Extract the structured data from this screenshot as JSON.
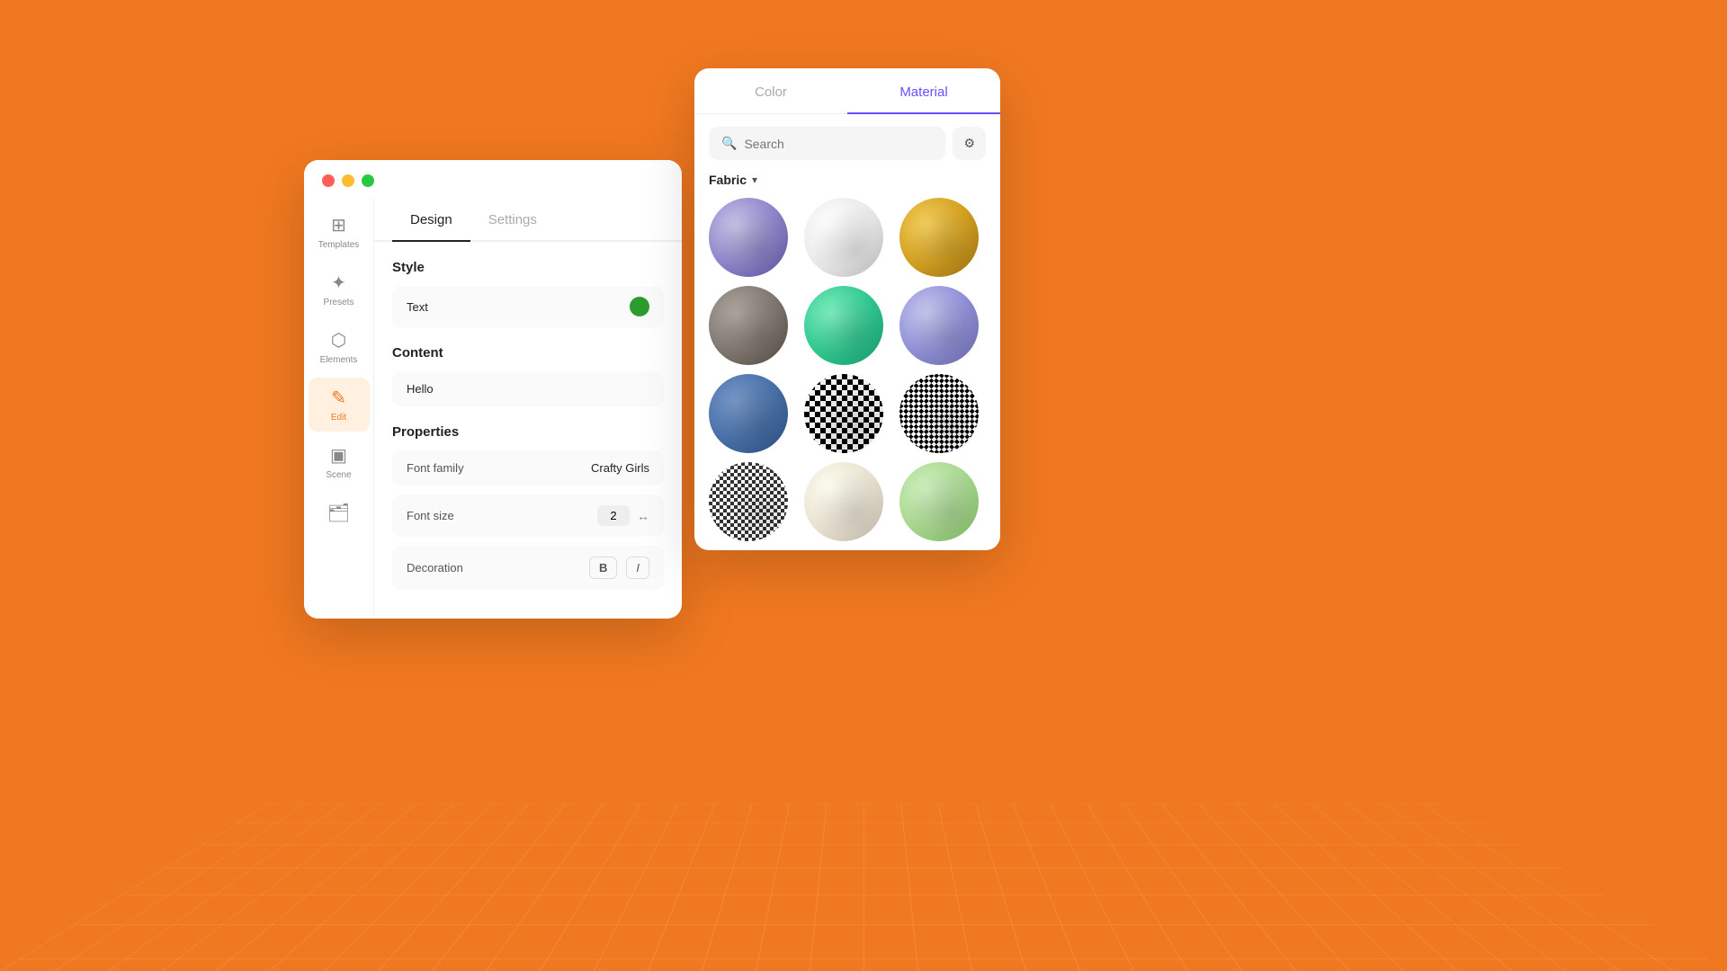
{
  "background": "#F07820",
  "left_panel": {
    "tabs": [
      {
        "id": "design",
        "label": "Design",
        "active": true
      },
      {
        "id": "settings",
        "label": "Settings",
        "active": false
      }
    ],
    "sidebar_items": [
      {
        "id": "templates",
        "label": "Templates",
        "icon": "⊞",
        "active": false
      },
      {
        "id": "presets",
        "label": "Presets",
        "icon": "✦",
        "active": false
      },
      {
        "id": "elements",
        "label": "Elements",
        "icon": "⬡",
        "active": false
      },
      {
        "id": "edit",
        "label": "Edit",
        "icon": "✎",
        "active": true
      },
      {
        "id": "scene",
        "label": "Scene",
        "icon": "▣",
        "active": false
      },
      {
        "id": "folder",
        "label": "",
        "icon": "🗂",
        "active": false
      }
    ],
    "style_section": {
      "title": "Style",
      "value": "Text"
    },
    "content_section": {
      "title": "Content",
      "value": "Hello"
    },
    "properties_section": {
      "title": "Properties",
      "font_family_label": "Font family",
      "font_family_value": "Crafty Girls",
      "font_size_label": "Font size",
      "font_size_value": "2",
      "decoration_label": "Decoration",
      "bold_label": "B",
      "italic_label": "I"
    }
  },
  "right_panel": {
    "tabs": [
      {
        "id": "color",
        "label": "Color",
        "active": false
      },
      {
        "id": "material",
        "label": "Material",
        "active": true
      }
    ],
    "search_placeholder": "Search",
    "filter_icon": "⚙",
    "fabric_label": "Fabric",
    "materials": [
      {
        "id": "lavender",
        "class": "mat-lavender"
      },
      {
        "id": "white-knit",
        "class": "mat-white-knit"
      },
      {
        "id": "gold",
        "class": "mat-gold"
      },
      {
        "id": "gray",
        "class": "mat-gray"
      },
      {
        "id": "mint",
        "class": "mat-mint"
      },
      {
        "id": "periwinkle",
        "class": "mat-periwinkle"
      },
      {
        "id": "blue-denim",
        "class": "mat-blue-denim"
      },
      {
        "id": "houndstooth",
        "class": "mat-houndstooth"
      },
      {
        "id": "zigzag",
        "class": "mat-zigzag"
      },
      {
        "id": "houndstooth-sm",
        "class": "mat-houndstooth-sm"
      },
      {
        "id": "cream-knit",
        "class": "mat-cream-knit"
      },
      {
        "id": "light-green",
        "class": "mat-light-green"
      }
    ]
  }
}
